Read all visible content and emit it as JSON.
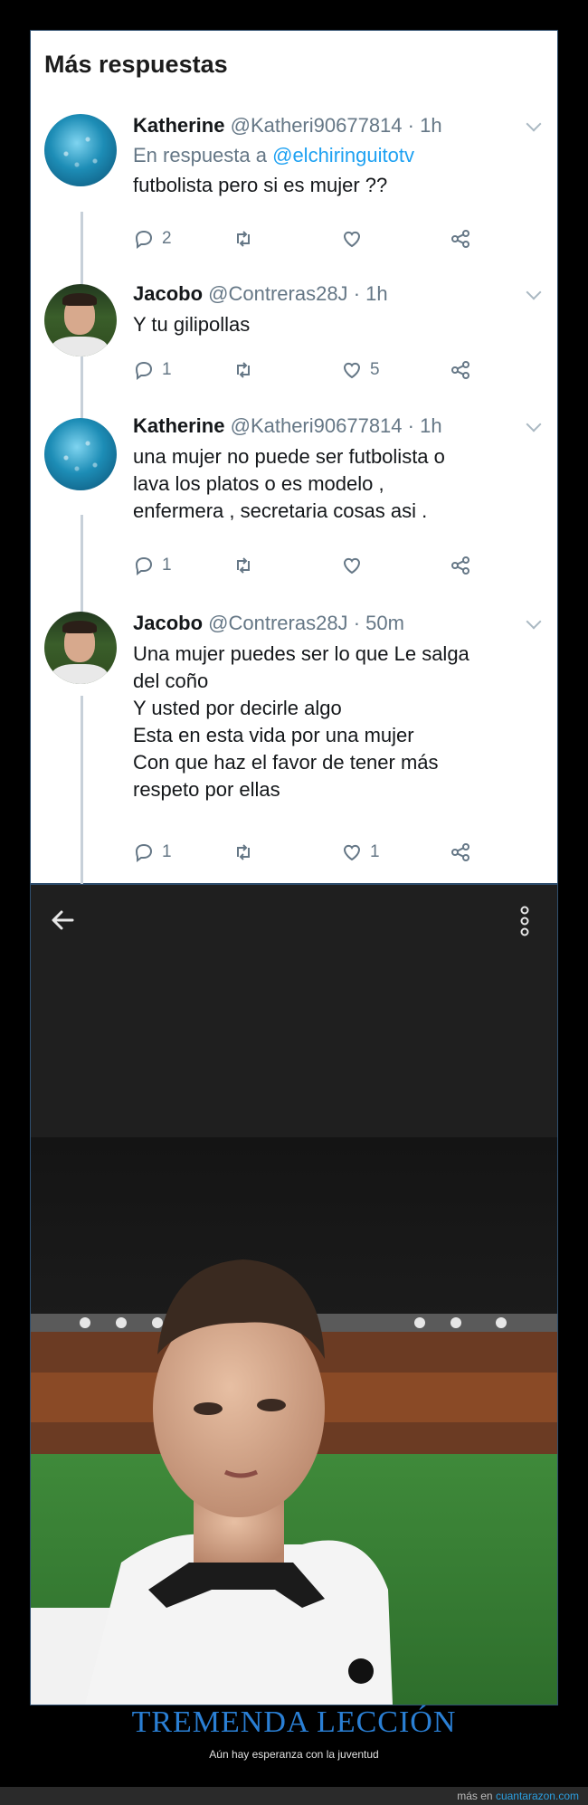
{
  "twitter": {
    "section_title": "Más respuestas",
    "tweets": [
      {
        "name": "Katherine",
        "handle": "@Katheri90677814",
        "time": "· 1h",
        "reply_prefix": "En respuesta a",
        "reply_mention": "@elchiringuitotv",
        "text": "futbolista pero si es mujer ??",
        "replies": "2",
        "retweets": "",
        "likes": ""
      },
      {
        "name": "Jacobo",
        "handle": "@Contreras28J",
        "time": "· 1h",
        "text": "Y tu gilipollas",
        "replies": "1",
        "retweets": "",
        "likes": "5"
      },
      {
        "name": "Katherine",
        "handle": "@Katheri90677814",
        "time": "· 1h",
        "text": "una mujer no puede ser futbolista o\nlava los platos o es modelo ,\nenfermera , secretaria cosas asi .",
        "replies": "1",
        "retweets": "",
        "likes": ""
      },
      {
        "name": "Jacobo",
        "handle": "@Contreras28J",
        "time": "· 50m",
        "text": "Una mujer puedes ser lo que Le salga\ndel coño\nY usted por decirle algo\nEsta en esta vida por una mujer\nCon que haz el favor de tener más\nrespeto por ellas",
        "replies": "1",
        "retweets": "",
        "likes": "1"
      }
    ]
  },
  "icons": {
    "back": "arrow-left-icon",
    "more": "more-vertical-icon",
    "reply": "reply-icon",
    "retweet": "retweet-icon",
    "like": "heart-icon",
    "share": "share-icon"
  },
  "caption": {
    "title": "TREMENDA LECCIÓN",
    "subtitle": "Aún hay esperanza con la juventud"
  },
  "footer": {
    "prefix": "más en",
    "site": "cuantarazon.com"
  },
  "colors": {
    "twitter_blue": "#1da1f2",
    "caption_blue": "#2a7fd4",
    "link_blue": "#2a9fe0"
  }
}
